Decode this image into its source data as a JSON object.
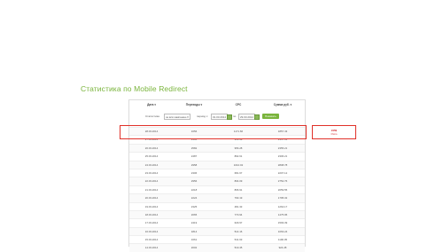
{
  "page_title": "Статистика по Mobile Redirect",
  "table": {
    "headers": [
      "Дата ▾",
      "Переходы ▾",
      "CPC",
      "Сумма руб. ▾"
    ],
    "filter": {
      "label": "Статистика",
      "select_value": "за всё кампанию",
      "from_label": "период с",
      "from_date": "01.03.2014",
      "to_label": "по",
      "to_date": "29.03.2014",
      "button": "Показать"
    },
    "rows": [
      [
        "28.03.2014",
        "1656",
        "1171.66",
        "1857.43"
      ],
      [
        "27.03.2014",
        "2406",
        "950.99",
        "2347.61"
      ],
      [
        "26.03.2014",
        "2582",
        "956.28",
        "2355.21"
      ],
      [
        "25.03.2014",
        "2487",
        "892.61",
        "2306.21"
      ],
      [
        "24.03.2014",
        "2958",
        "1010.02",
        "2808.78"
      ],
      [
        "23.03.2014",
        "2306",
        "681.67",
        "2207.12"
      ],
      [
        "22.03.2014",
        "2956",
        "804.09",
        "2752.76"
      ],
      [
        "21.03.2014",
        "2218",
        "806.91",
        "2059.55"
      ],
      [
        "20.03.2014",
        "2224",
        "793.19",
        "1795.32"
      ],
      [
        "19.03.2014",
        "2325",
        "481.33",
        "1264.17"
      ],
      [
        "18.03.2014",
        "2065",
        "770.94",
        "1475.95"
      ],
      [
        "17.03.2014",
        "2419",
        "629.97",
        "1593.39"
      ],
      [
        "16.03.2014",
        "1814",
        "514.16",
        "1063.24"
      ],
      [
        "15.03.2014",
        "1661",
        "541.63",
        "1190.05"
      ],
      [
        "14.03.2014",
        "2002",
        "519.45",
        "924.28"
      ]
    ]
  },
  "annotation": {
    "value": "245$",
    "text": "Итого"
  }
}
